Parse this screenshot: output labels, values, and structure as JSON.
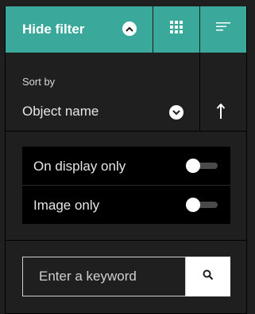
{
  "toolbar": {
    "hide_filter_label": "Hide filter",
    "hide_filter_icon": "chevron-up-icon",
    "grid_icon": "grid-view-icon",
    "list_icon": "list-sort-icon",
    "accent_color": "#3aa89a"
  },
  "sort": {
    "label": "Sort by",
    "selected": "Object name",
    "dropdown_icon": "chevron-down-icon",
    "direction_icon": "arrow-up-icon"
  },
  "filters": {
    "on_display_only": {
      "label": "On display only",
      "checked": false
    },
    "image_only": {
      "label": "Image only",
      "checked": false
    }
  },
  "search": {
    "placeholder": "Enter a keyword",
    "value": "",
    "button_icon": "search-icon"
  }
}
